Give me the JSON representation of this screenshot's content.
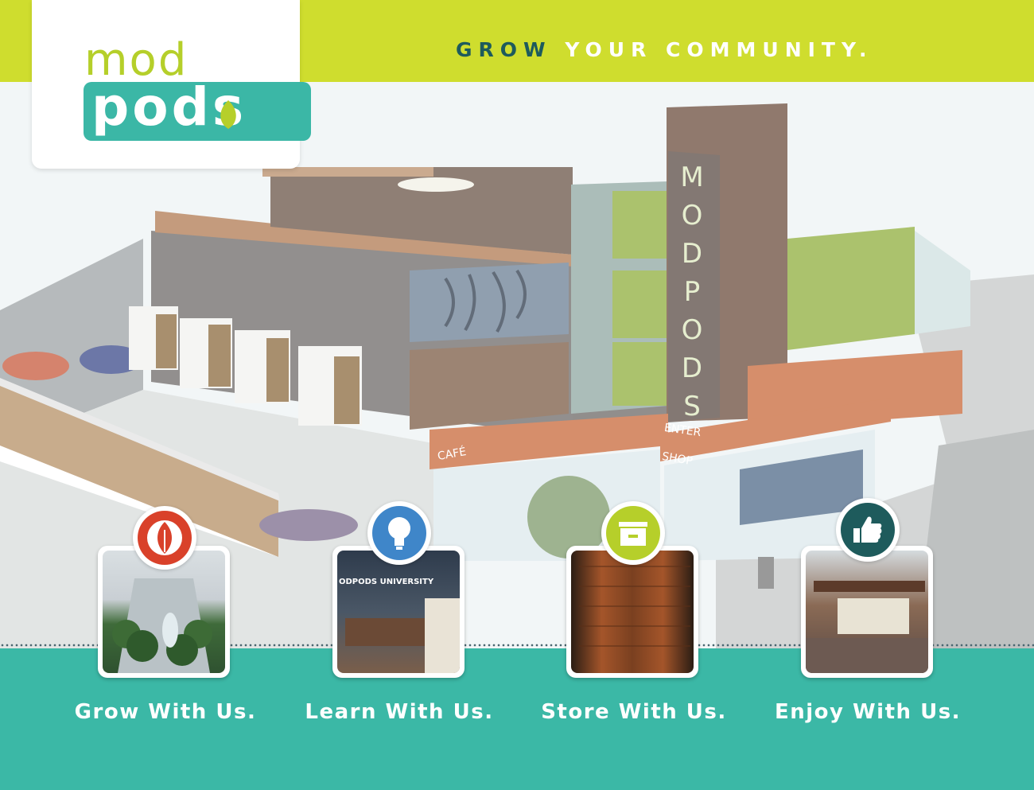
{
  "header": {
    "tagline_highlight": "GROW",
    "tagline_rest": "YOUR COMMUNITY."
  },
  "logo": {
    "line1": "mod",
    "line2": "pods"
  },
  "building": {
    "tower_sign": "MODPODS",
    "sign_cafe": "CAFÉ",
    "sign_enter": "ENTER",
    "sign_shop": "SHOP",
    "photo_sign": "ODPODS UNIVERSITY"
  },
  "features": [
    {
      "caption": "Grow With Us.",
      "icon": "leaf-icon",
      "color": "#d9412a"
    },
    {
      "caption": "Learn With Us.",
      "icon": "lightbulb-icon",
      "color": "#3f86c9"
    },
    {
      "caption": "Store With Us.",
      "icon": "file-drawer-icon",
      "color": "#b6cf2a"
    },
    {
      "caption": "Enjoy With Us.",
      "icon": "thumbs-up-icon",
      "color": "#1e5b5c"
    }
  ],
  "colors": {
    "lime": "#cfdd2e",
    "teal": "#3bb8a6",
    "dark_teal": "#1e5b5c",
    "brick": "#c8683a"
  }
}
